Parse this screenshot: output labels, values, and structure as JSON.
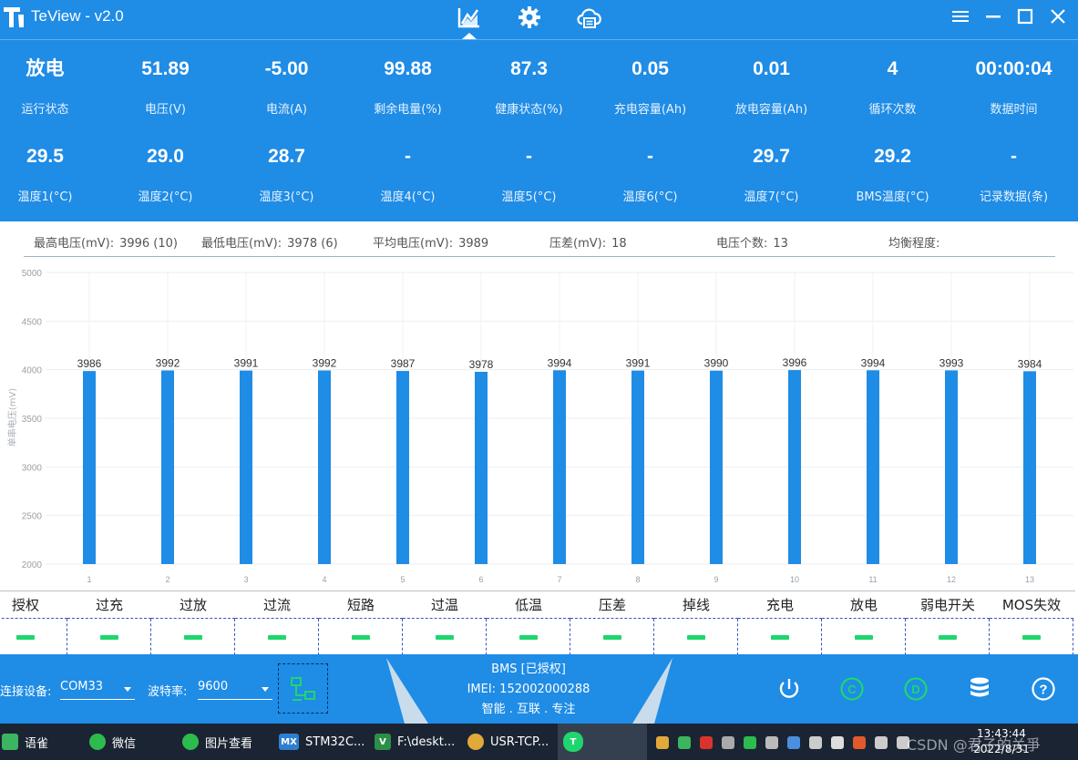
{
  "window": {
    "title": "TeView - v2.0"
  },
  "stats_row1": [
    {
      "value": "放电",
      "label": "运行状态"
    },
    {
      "value": "51.89",
      "label": "电压(V)"
    },
    {
      "value": "-5.00",
      "label": "电流(A)"
    },
    {
      "value": "99.88",
      "label": "剩余电量(%)"
    },
    {
      "value": "87.3",
      "label": "健康状态(%)"
    },
    {
      "value": "0.05",
      "label": "充电容量(Ah)"
    },
    {
      "value": "0.01",
      "label": "放电容量(Ah)"
    },
    {
      "value": "4",
      "label": "循环次数"
    },
    {
      "value": "00:00:04",
      "label": "数据时间"
    }
  ],
  "stats_row2": [
    {
      "value": "29.5",
      "label": "温度1(°C)"
    },
    {
      "value": "29.0",
      "label": "温度2(°C)"
    },
    {
      "value": "28.7",
      "label": "温度3(°C)"
    },
    {
      "value": "-",
      "label": "温度4(°C)"
    },
    {
      "value": "-",
      "label": "温度5(°C)"
    },
    {
      "value": "-",
      "label": "温度6(°C)"
    },
    {
      "value": "29.7",
      "label": "温度7(°C)"
    },
    {
      "value": "29.2",
      "label": "BMS温度(°C)"
    },
    {
      "value": "-",
      "label": "记录数据(条)"
    }
  ],
  "summary": {
    "max_label": "最高电压(mV):",
    "max_value": "3996 (10)",
    "min_label": "最低电压(mV):",
    "min_value": "3978 (6)",
    "avg_label": "平均电压(mV):",
    "avg_value": "3989",
    "diff_label": "压差(mV):",
    "diff_value": "18",
    "count_label": "电压个数:",
    "count_value": "13",
    "balance_label": "均衡程度:",
    "balance_value": ""
  },
  "chart_data": {
    "type": "bar",
    "ylabel": "单串电压(mV)",
    "ylim": [
      2000,
      5000
    ],
    "yticks": [
      2000,
      2500,
      3000,
      3500,
      4000,
      4500,
      5000
    ],
    "categories": [
      "1",
      "2",
      "3",
      "4",
      "5",
      "6",
      "7",
      "8",
      "9",
      "10",
      "11",
      "12",
      "13"
    ],
    "values": [
      3986,
      3992,
      3991,
      3992,
      3987,
      3978,
      3994,
      3991,
      3990,
      3996,
      3994,
      3993,
      3984
    ],
    "bar_color": "#1f8ce6",
    "grid": true
  },
  "alarms": [
    "授权",
    "过充",
    "过放",
    "过流",
    "短路",
    "过温",
    "低温",
    "压差",
    "掉线",
    "充电",
    "放电",
    "弱电开关",
    "MOS失效"
  ],
  "alarm_ok_color": "#1fd66e",
  "connection": {
    "device_label": "连接设备:",
    "device_value": "COM33",
    "baud_label": "波特率:",
    "baud_value": "9600"
  },
  "device_info": {
    "line1": "BMS [已授权]",
    "line2": "IMEI: 152002000288",
    "line3": "智能 . 互联 . 专注"
  },
  "taskbar": {
    "items": [
      "语雀",
      "微信",
      "图片查看",
      "STM32C...",
      "F:\\deskt...",
      "USR-TCP..."
    ],
    "watermark": "CSDN @君子的关爭",
    "time": "13:43:44",
    "date": "2022/8/31"
  },
  "colors": {
    "primary": "#1f8ce6",
    "ok": "#1fd66e",
    "taskbar": "#1b2433"
  }
}
